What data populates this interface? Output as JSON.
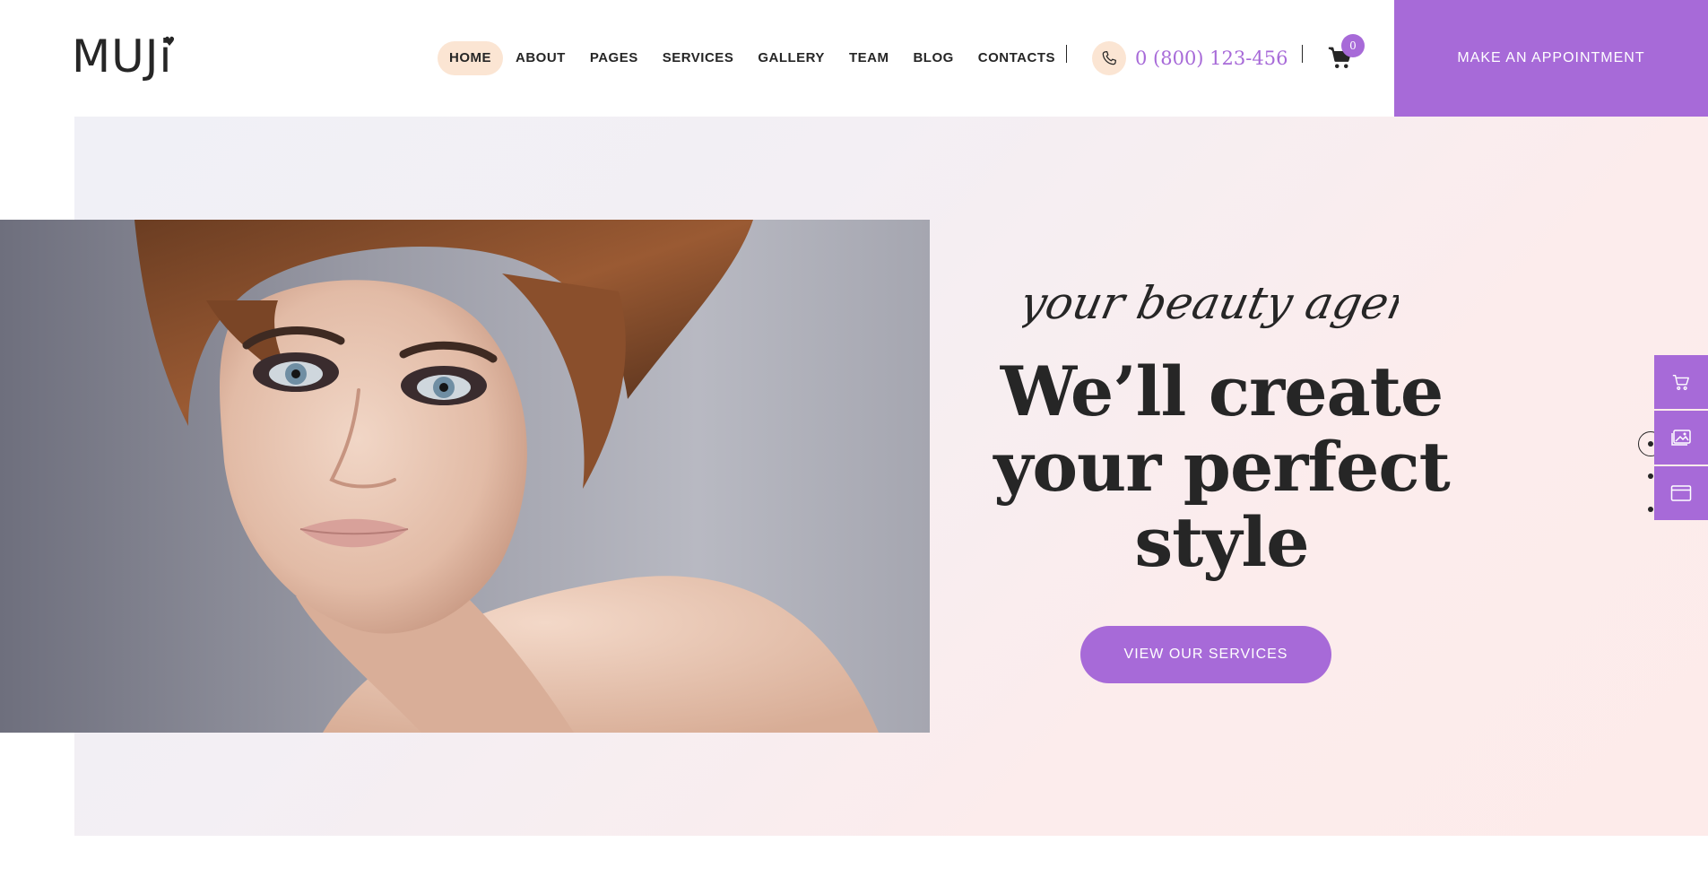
{
  "header": {
    "logo_text": "MUJi",
    "nav": [
      {
        "label": "HOME",
        "active": true
      },
      {
        "label": "ABOUT",
        "active": false
      },
      {
        "label": "PAGES",
        "active": false
      },
      {
        "label": "SERVICES",
        "active": false
      },
      {
        "label": "GALLERY",
        "active": false
      },
      {
        "label": "TEAM",
        "active": false
      },
      {
        "label": "BLOG",
        "active": false
      },
      {
        "label": "CONTACTS",
        "active": false
      }
    ],
    "phone": "0 (800) 123-456",
    "cart_count": "0",
    "appointment_label": "MAKE AN APPOINTMENT"
  },
  "hero": {
    "script_text": "your beauty agent",
    "title_line1": "We’ll create",
    "title_line2": "your perfect",
    "title_line3": "style",
    "cta_label": "VIEW OUR SERVICES"
  },
  "side_panel": {
    "icons": [
      "cart-icon",
      "gallery-icon",
      "browser-window-icon"
    ]
  },
  "colors": {
    "accent": "#a76ad8",
    "accent_soft": "#fbe5d3",
    "text": "#262626"
  }
}
